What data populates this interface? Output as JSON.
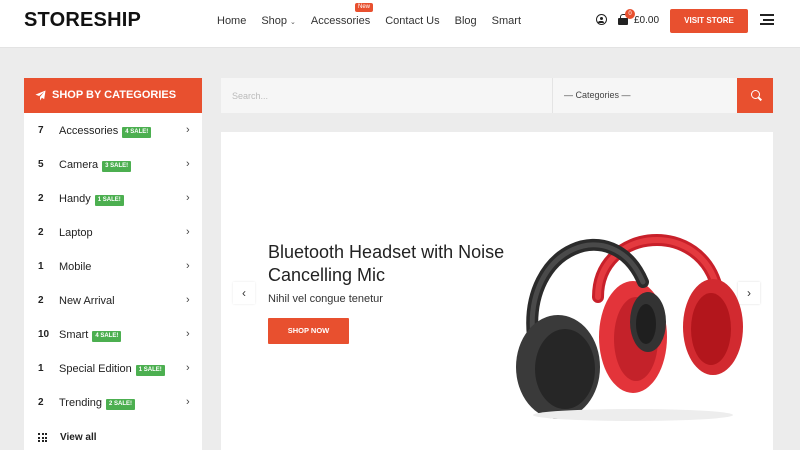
{
  "header": {
    "logo": "STORESHIP",
    "nav": [
      {
        "label": "Home",
        "has_dropdown": false
      },
      {
        "label": "Shop",
        "has_dropdown": true
      },
      {
        "label": "Accessories",
        "has_dropdown": false
      },
      {
        "label": "Contact Us",
        "has_dropdown": false
      },
      {
        "label": "Blog",
        "has_dropdown": false
      },
      {
        "label": "Smart",
        "has_dropdown": false
      }
    ],
    "new_badge": "New",
    "cart_count": "0",
    "cart_total": "£0.00",
    "visit_store": "VISIT STORE"
  },
  "sidebar": {
    "title": "SHOP BY CATEGORIES",
    "categories": [
      {
        "count": "7",
        "name": "Accessories",
        "sale": "4 SALE!"
      },
      {
        "count": "5",
        "name": "Camera",
        "sale": "3 SALE!"
      },
      {
        "count": "2",
        "name": "Handy",
        "sale": "1 SALE!"
      },
      {
        "count": "2",
        "name": "Laptop",
        "sale": ""
      },
      {
        "count": "1",
        "name": "Mobile",
        "sale": ""
      },
      {
        "count": "2",
        "name": "New Arrival",
        "sale": ""
      },
      {
        "count": "10",
        "name": "Smart",
        "sale": "4 SALE!"
      },
      {
        "count": "1",
        "name": "Special Edition",
        "sale": "1 SALE!"
      },
      {
        "count": "2",
        "name": "Trending",
        "sale": "2 SALE!"
      }
    ],
    "view_all": "View all"
  },
  "search": {
    "placeholder": "Search...",
    "category_select": "— Categories —"
  },
  "hero": {
    "title": "Bluetooth Headset with Noise Cancelling Mic",
    "subtitle": "Nihil vel congue tenetur",
    "button": "SHOP NOW"
  },
  "colors": {
    "accent": "#e8502f",
    "sale_badge": "#4caf50",
    "page_bg": "#ececec"
  }
}
